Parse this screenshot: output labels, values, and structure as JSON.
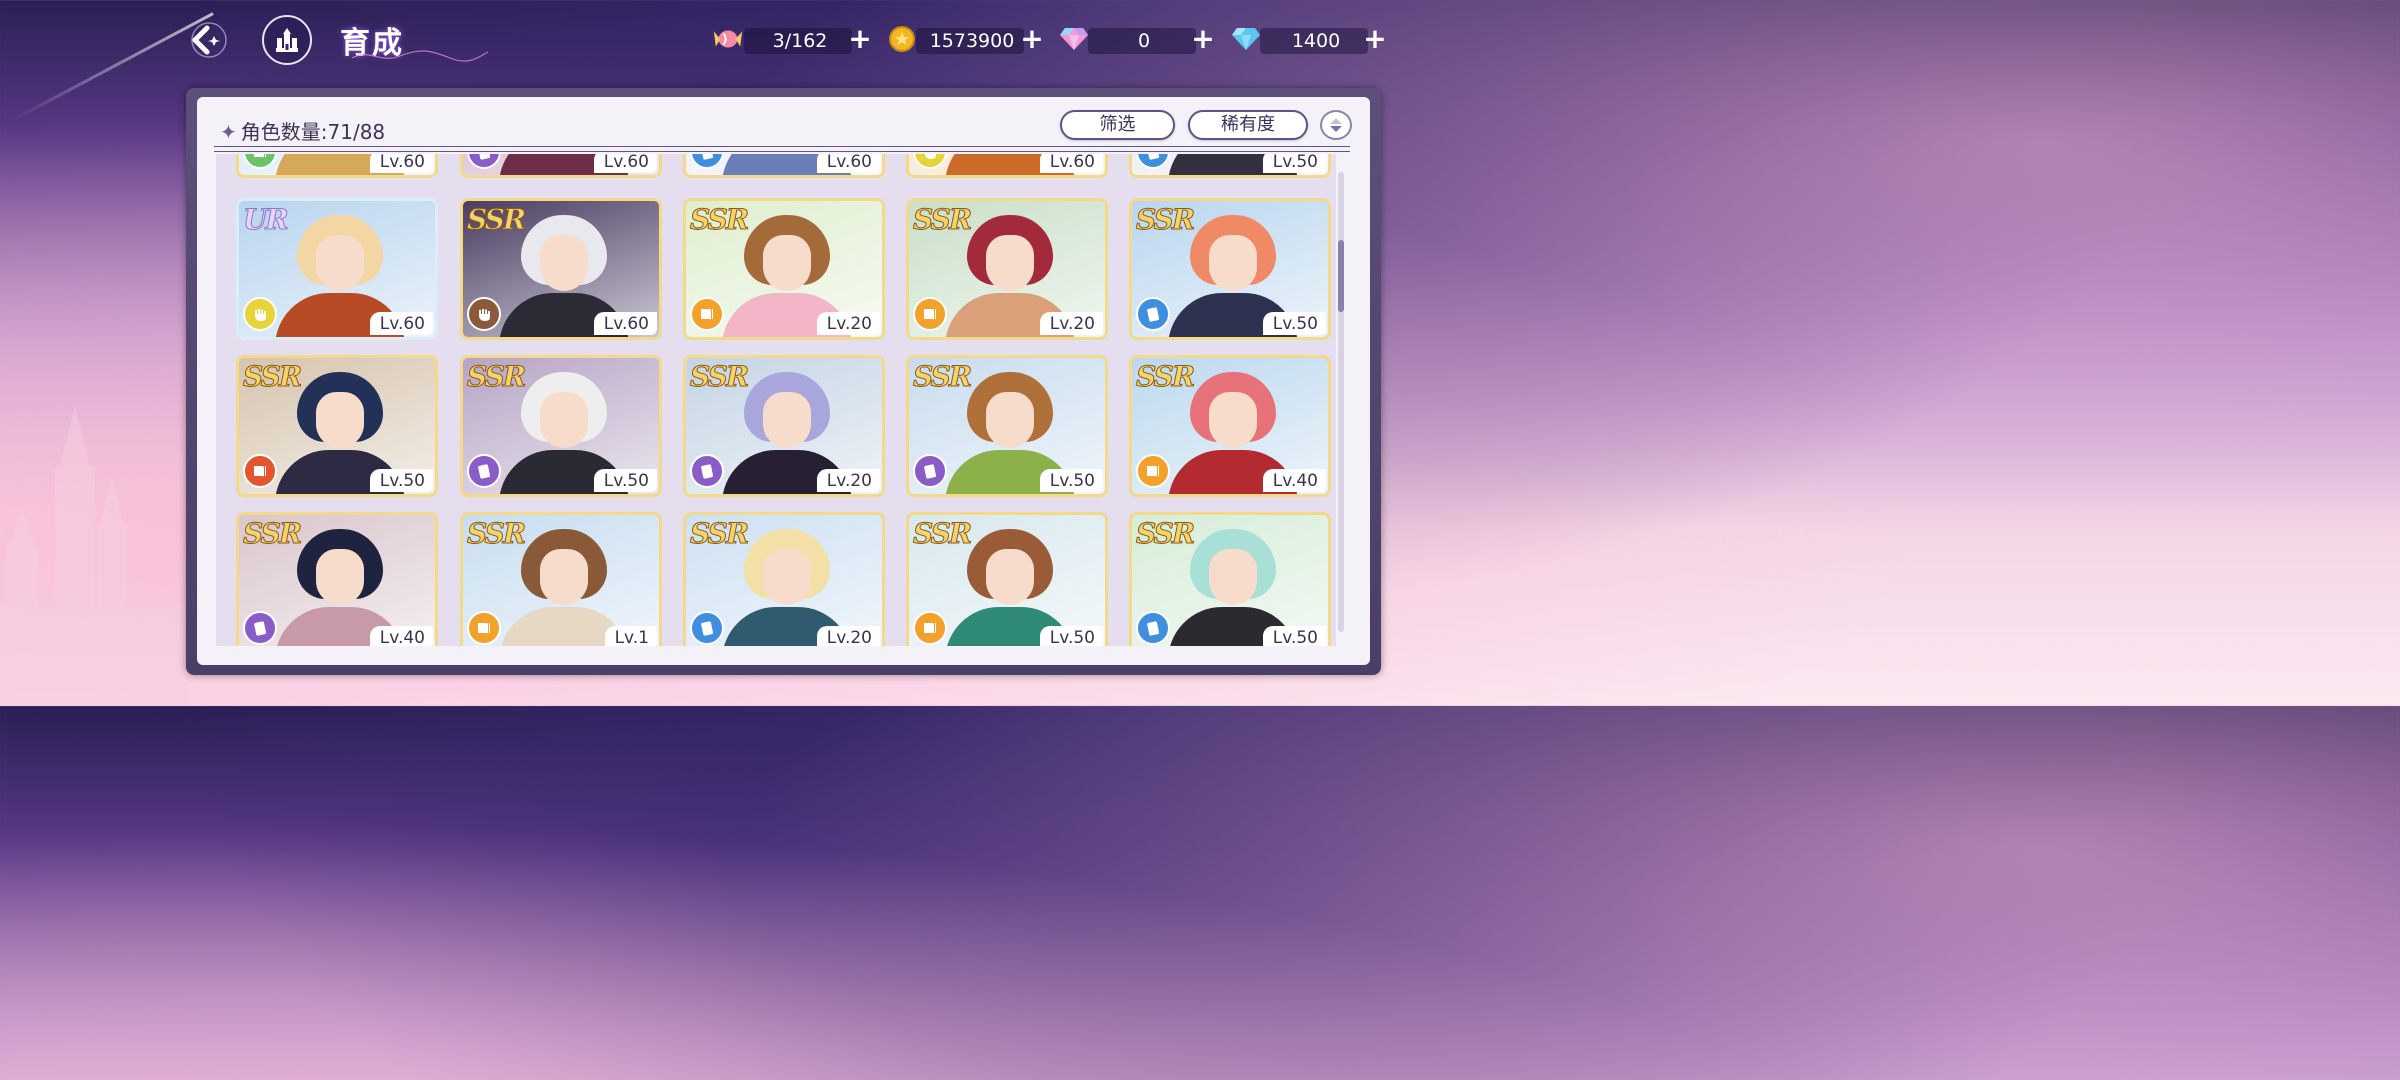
{
  "header": {
    "title": "育成",
    "resources": [
      {
        "icon": "candy-icon",
        "value": "3/162",
        "has_plus": true
      },
      {
        "icon": "gold-coin-icon",
        "value": "1573900",
        "has_plus": true
      },
      {
        "icon": "rainbow-gem-icon",
        "value": "0",
        "has_plus": true
      },
      {
        "icon": "blue-diamond-icon",
        "value": "1400",
        "has_plus": true
      }
    ]
  },
  "panel": {
    "count_label": "角色数量:71/88",
    "filter_button": "筛选",
    "sort_button": "稀有度"
  },
  "colors": {
    "accent": "#5e5384",
    "ssr_gold": "#f5d46a",
    "ur_border": "#d9edfb"
  },
  "cards": [
    {
      "rarity": "",
      "type": "green",
      "level": "Lv.60",
      "hair": "#e6c89a",
      "bg": "#cfe6f6",
      "outfit": "#d6a85a"
    },
    {
      "rarity": "",
      "type": "purple",
      "level": "Lv.60",
      "hair": "#ede6f2",
      "bg": "#caa4c8",
      "outfit": "#6e2e49"
    },
    {
      "rarity": "",
      "type": "blue",
      "level": "Lv.60",
      "hair": "#c9d4ee",
      "bg": "#e8eaf6",
      "outfit": "#6a7fb8"
    },
    {
      "rarity": "",
      "type": "yellow",
      "level": "Lv.60",
      "hair": "#f0c08a",
      "bg": "#f3dcc0",
      "outfit": "#cc6a2a"
    },
    {
      "rarity": "",
      "type": "blue",
      "level": "Lv.50",
      "hair": "#cfd8ea",
      "bg": "#e6e4ee",
      "outfit": "#333040"
    },
    {
      "rarity": "UR",
      "type": "yellow",
      "level": "Lv.60",
      "hair": "#f4d6a4",
      "bg": "#b8d4ee",
      "outfit": "#b94a26"
    },
    {
      "rarity": "SSR",
      "type": "brown",
      "level": "Lv.60",
      "hair": "#e8e8ee",
      "bg": "#4a3c62",
      "outfit": "#2c2a34"
    },
    {
      "rarity": "SSR",
      "type": "orange",
      "level": "Lv.20",
      "hair": "#a56a3a",
      "bg": "#dfeecf",
      "outfit": "#f2b6c8"
    },
    {
      "rarity": "SSR",
      "type": "orange",
      "level": "Lv.20",
      "hair": "#a32a3a",
      "bg": "#c9dfc8",
      "outfit": "#d9a07a"
    },
    {
      "rarity": "SSR",
      "type": "blue",
      "level": "Lv.50",
      "hair": "#f08a66",
      "bg": "#b9d6ee",
      "outfit": "#2e3250"
    },
    {
      "rarity": "SSR",
      "type": "red",
      "level": "Lv.50",
      "hair": "#233158",
      "bg": "#d6c4ae",
      "outfit": "#2e2a44"
    },
    {
      "rarity": "SSR",
      "type": "purple",
      "level": "Lv.50",
      "hair": "#eeeeef",
      "bg": "#b7a4c4",
      "outfit": "#2a2a34"
    },
    {
      "rarity": "SSR",
      "type": "purple",
      "level": "Lv.20",
      "hair": "#a9a6dc",
      "bg": "#c4d4e4",
      "outfit": "#262032"
    },
    {
      "rarity": "SSR",
      "type": "purple",
      "level": "Lv.50",
      "hair": "#b0703a",
      "bg": "#c8dcee",
      "outfit": "#8cb04a"
    },
    {
      "rarity": "SSR",
      "type": "orange",
      "level": "Lv.40",
      "hair": "#e8727a",
      "bg": "#bcd8ee",
      "outfit": "#b32a30"
    },
    {
      "rarity": "SSR",
      "type": "purple",
      "level": "Lv.40",
      "hair": "#1e2440",
      "bg": "#d9c6cc",
      "outfit": "#c89aa8"
    },
    {
      "rarity": "SSR",
      "type": "orange",
      "level": "Lv.1",
      "hair": "#8a5a38",
      "bg": "#c7ddf0",
      "outfit": "#e6d8c4"
    },
    {
      "rarity": "SSR",
      "type": "blue",
      "level": "Lv.20",
      "hair": "#f2e0a6",
      "bg": "#cde0f2",
      "outfit": "#2f5a70"
    },
    {
      "rarity": "SSR",
      "type": "orange",
      "level": "Lv.50",
      "hair": "#9a5c38",
      "bg": "#d8e8ee",
      "outfit": "#2f8a78"
    },
    {
      "rarity": "SSR",
      "type": "blue",
      "level": "Lv.50",
      "hair": "#a8e0d8",
      "bg": "#d6ecd8",
      "outfit": "#2a2a30"
    }
  ]
}
